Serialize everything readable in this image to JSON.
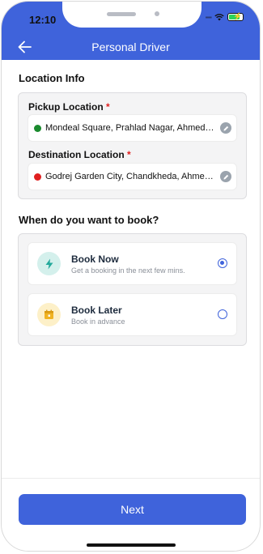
{
  "status_bar": {
    "time": "12:10"
  },
  "app_bar": {
    "title": "Personal Driver"
  },
  "location_info": {
    "title": "Location Info",
    "pickup": {
      "label": "Pickup Location",
      "required_mark": "*",
      "value": "Mondeal Square, Prahlad Nagar, Ahmedabad, Gujarat",
      "dot_color": "#1a8a2e"
    },
    "destination": {
      "label": "Destination Location",
      "required_mark": "*",
      "value": "Godrej Garden City, Chandkheda, Ahmedabad, Gujarat",
      "dot_color": "#e02020"
    }
  },
  "booking": {
    "title": "When do you want to book?",
    "options": [
      {
        "title": "Book Now",
        "subtitle": "Get a booking in the next few mins.",
        "icon": "lightning-icon",
        "selected": true
      },
      {
        "title": "Book Later",
        "subtitle": "Book in advance",
        "icon": "calendar-icon",
        "selected": false
      }
    ]
  },
  "next_button": {
    "label": "Next"
  },
  "colors": {
    "accent": "#3f63db",
    "book_now_icon_bg": "#d4f0ec",
    "book_later_icon_bg": "#fdf0c8"
  }
}
